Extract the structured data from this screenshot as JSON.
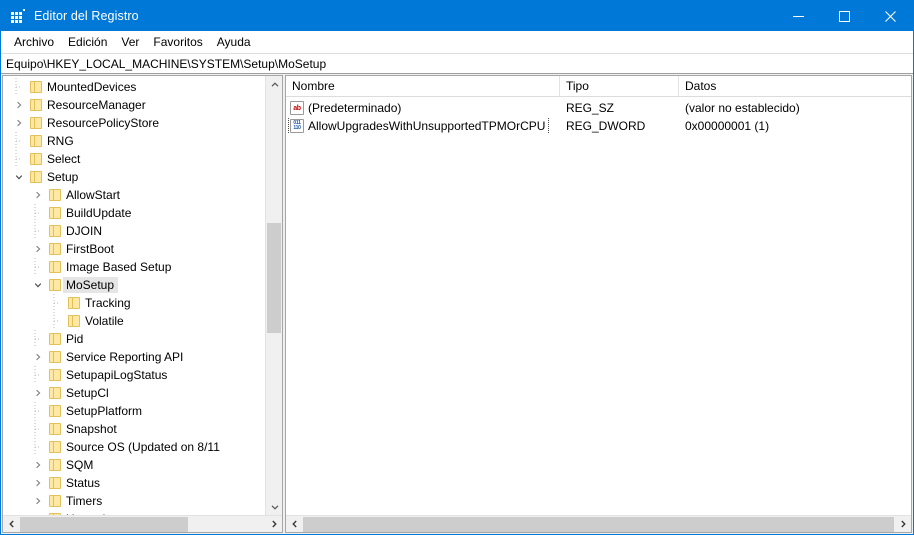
{
  "window": {
    "title": "Editor del Registro",
    "icon": "registry-icon",
    "minimize_label": "Minimizar",
    "maximize_label": "Maximizar",
    "close_label": "Cerrar"
  },
  "menubar": {
    "items": [
      {
        "label": "Archivo"
      },
      {
        "label": "Edición"
      },
      {
        "label": "Ver"
      },
      {
        "label": "Favoritos"
      },
      {
        "label": "Ayuda"
      }
    ]
  },
  "address": {
    "path": "Equipo\\HKEY_LOCAL_MACHINE\\SYSTEM\\Setup\\MoSetup"
  },
  "tree": {
    "items": [
      {
        "label": "MountedDevices",
        "depth": 2,
        "twisty": "none",
        "selected": false
      },
      {
        "label": "ResourceManager",
        "depth": 2,
        "twisty": "collapsed",
        "selected": false
      },
      {
        "label": "ResourcePolicyStore",
        "depth": 2,
        "twisty": "collapsed",
        "selected": false
      },
      {
        "label": "RNG",
        "depth": 2,
        "twisty": "none",
        "selected": false
      },
      {
        "label": "Select",
        "depth": 2,
        "twisty": "none",
        "selected": false
      },
      {
        "label": "Setup",
        "depth": 2,
        "twisty": "expanded",
        "selected": false
      },
      {
        "label": "AllowStart",
        "depth": 3,
        "twisty": "collapsed",
        "selected": false
      },
      {
        "label": "BuildUpdate",
        "depth": 3,
        "twisty": "none",
        "selected": false
      },
      {
        "label": "DJOIN",
        "depth": 3,
        "twisty": "none",
        "selected": false
      },
      {
        "label": "FirstBoot",
        "depth": 3,
        "twisty": "collapsed",
        "selected": false
      },
      {
        "label": "Image Based Setup",
        "depth": 3,
        "twisty": "none",
        "selected": false
      },
      {
        "label": "MoSetup",
        "depth": 3,
        "twisty": "expanded",
        "selected": true
      },
      {
        "label": "Tracking",
        "depth": 4,
        "twisty": "none",
        "selected": false
      },
      {
        "label": "Volatile",
        "depth": 4,
        "twisty": "none",
        "selected": false
      },
      {
        "label": "Pid",
        "depth": 3,
        "twisty": "none",
        "selected": false
      },
      {
        "label": "Service Reporting API",
        "depth": 3,
        "twisty": "collapsed",
        "selected": false
      },
      {
        "label": "SetupapiLogStatus",
        "depth": 3,
        "twisty": "none",
        "selected": false
      },
      {
        "label": "SetupCl",
        "depth": 3,
        "twisty": "collapsed",
        "selected": false
      },
      {
        "label": "SetupPlatform",
        "depth": 3,
        "twisty": "none",
        "selected": false
      },
      {
        "label": "Snapshot",
        "depth": 3,
        "twisty": "none",
        "selected": false
      },
      {
        "label": "Source OS (Updated on 8/11",
        "depth": 3,
        "twisty": "none",
        "selected": false
      },
      {
        "label": "SQM",
        "depth": 3,
        "twisty": "collapsed",
        "selected": false
      },
      {
        "label": "Status",
        "depth": 3,
        "twisty": "collapsed",
        "selected": false
      },
      {
        "label": "Timers",
        "depth": 3,
        "twisty": "collapsed",
        "selected": false
      },
      {
        "label": "Upgrade",
        "depth": 3,
        "twisty": "collapsed",
        "selected": false
      }
    ]
  },
  "values": {
    "columns": [
      {
        "label": "Nombre"
      },
      {
        "label": "Tipo"
      },
      {
        "label": "Datos"
      }
    ],
    "rows": [
      {
        "name": "(Predeterminado)",
        "type": "REG_SZ",
        "data": "(valor no establecido)",
        "icon": "string-value-icon",
        "icon_glyph": "ab",
        "focused": false
      },
      {
        "name": "AllowUpgradesWithUnsupportedTPMOrCPU",
        "type": "REG_DWORD",
        "data": "0x00000001 (1)",
        "icon": "dword-value-icon",
        "icon_glyph_top": "011",
        "icon_glyph_bottom": "110",
        "focused": true
      }
    ]
  },
  "colors": {
    "titlebar": "#0078d7",
    "selection": "#e5e5e5",
    "folder": "#ffe8a3",
    "scrollbar_thumb": "#cdcdcd"
  }
}
